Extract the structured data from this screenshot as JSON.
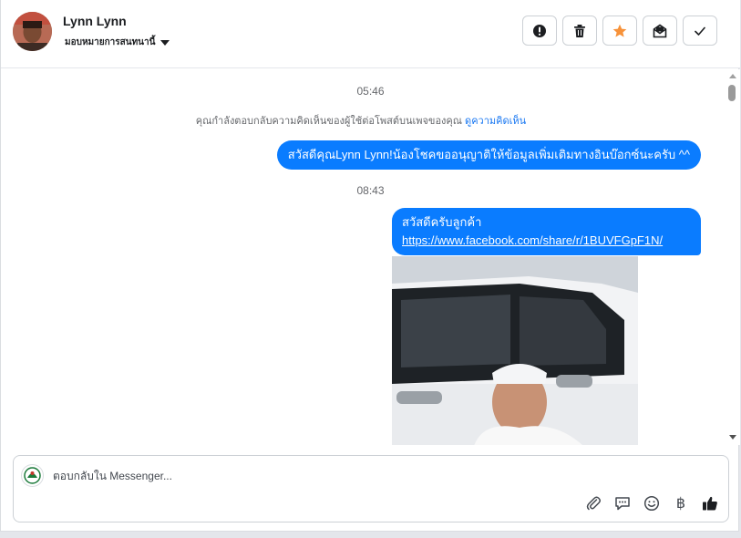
{
  "header": {
    "contact_name": "Lynn Lynn",
    "assign_label": "มอบหมายการสนทนานี้",
    "actions": [
      {
        "name": "report-button",
        "icon": "exclamation-icon"
      },
      {
        "name": "delete-button",
        "icon": "trash-icon"
      },
      {
        "name": "star-button",
        "icon": "star-icon"
      },
      {
        "name": "mark-unread-button",
        "icon": "envelope-icon"
      },
      {
        "name": "mark-done-button",
        "icon": "check-icon"
      }
    ],
    "star_color": "#f7923a"
  },
  "conversation": {
    "timestamp_1": "05:46",
    "notice_text": "คุณกำลังตอบกลับความคิดเห็นของผู้ใช้ต่อโพสต์บนเพจของคุณ",
    "notice_link": "ดูความคิดเห็น",
    "message_1": "สวัสดีคุณLynn Lynn!น้องโชคขออนุญาติให้ข้อมูลเพิ่มเติมทางอินบ๊อกซ์นะครับ ^^",
    "timestamp_2": "08:43",
    "message_2_text": "สวัสดีครับลูกค้า",
    "message_2_link": "https://www.facebook.com/share/r/1BUVFGpF1N/",
    "bubble_color": "#0a7cff"
  },
  "composer": {
    "placeholder": "ตอบกลับใน Messenger...",
    "tools": [
      "paperclip-icon",
      "speech-bubble-icon",
      "emoji-icon",
      "baht-icon",
      "thumbs-up-icon"
    ],
    "baht_symbol": "฿"
  }
}
